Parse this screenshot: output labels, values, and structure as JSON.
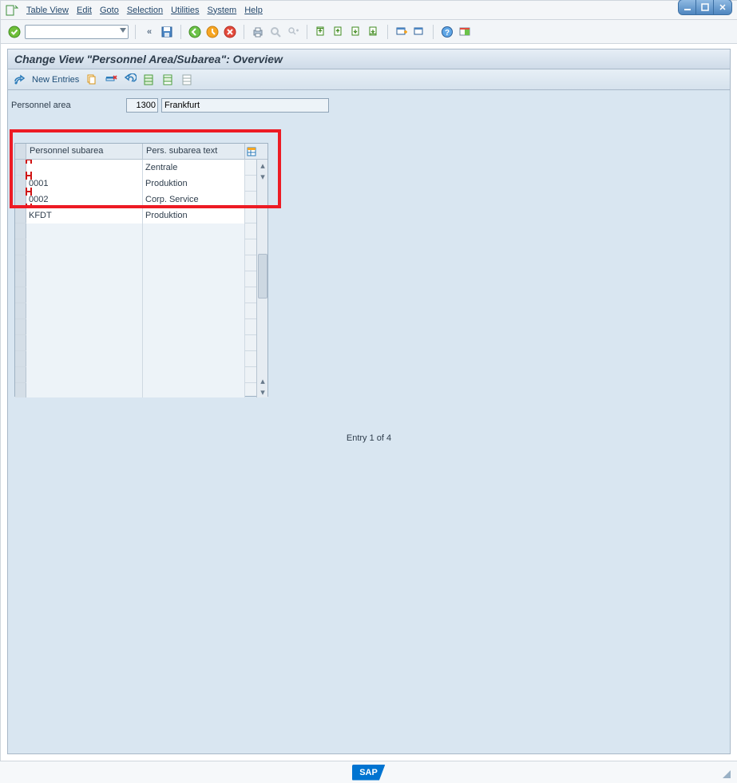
{
  "menu": {
    "items": [
      "Table View",
      "Edit",
      "Goto",
      "Selection",
      "Utilities",
      "System",
      "Help"
    ]
  },
  "title": "Change View \"Personnel Area/Subarea\": Overview",
  "app_toolbar": {
    "new_entries": "New Entries"
  },
  "personnel_area": {
    "label": "Personnel area",
    "code": "1300",
    "name": "Frankfurt"
  },
  "table": {
    "columns": [
      "Personnel subarea",
      "Pers. subarea text"
    ],
    "rows": [
      {
        "subarea": "",
        "text": "Zentrale"
      },
      {
        "subarea": "0001",
        "text": "Produktion"
      },
      {
        "subarea": "0002",
        "text": "Corp. Service"
      },
      {
        "subarea": "KFDT",
        "text": "Produktion"
      }
    ]
  },
  "entry_counter": "Entry 1 of 4",
  "sap_logo": "SAP"
}
